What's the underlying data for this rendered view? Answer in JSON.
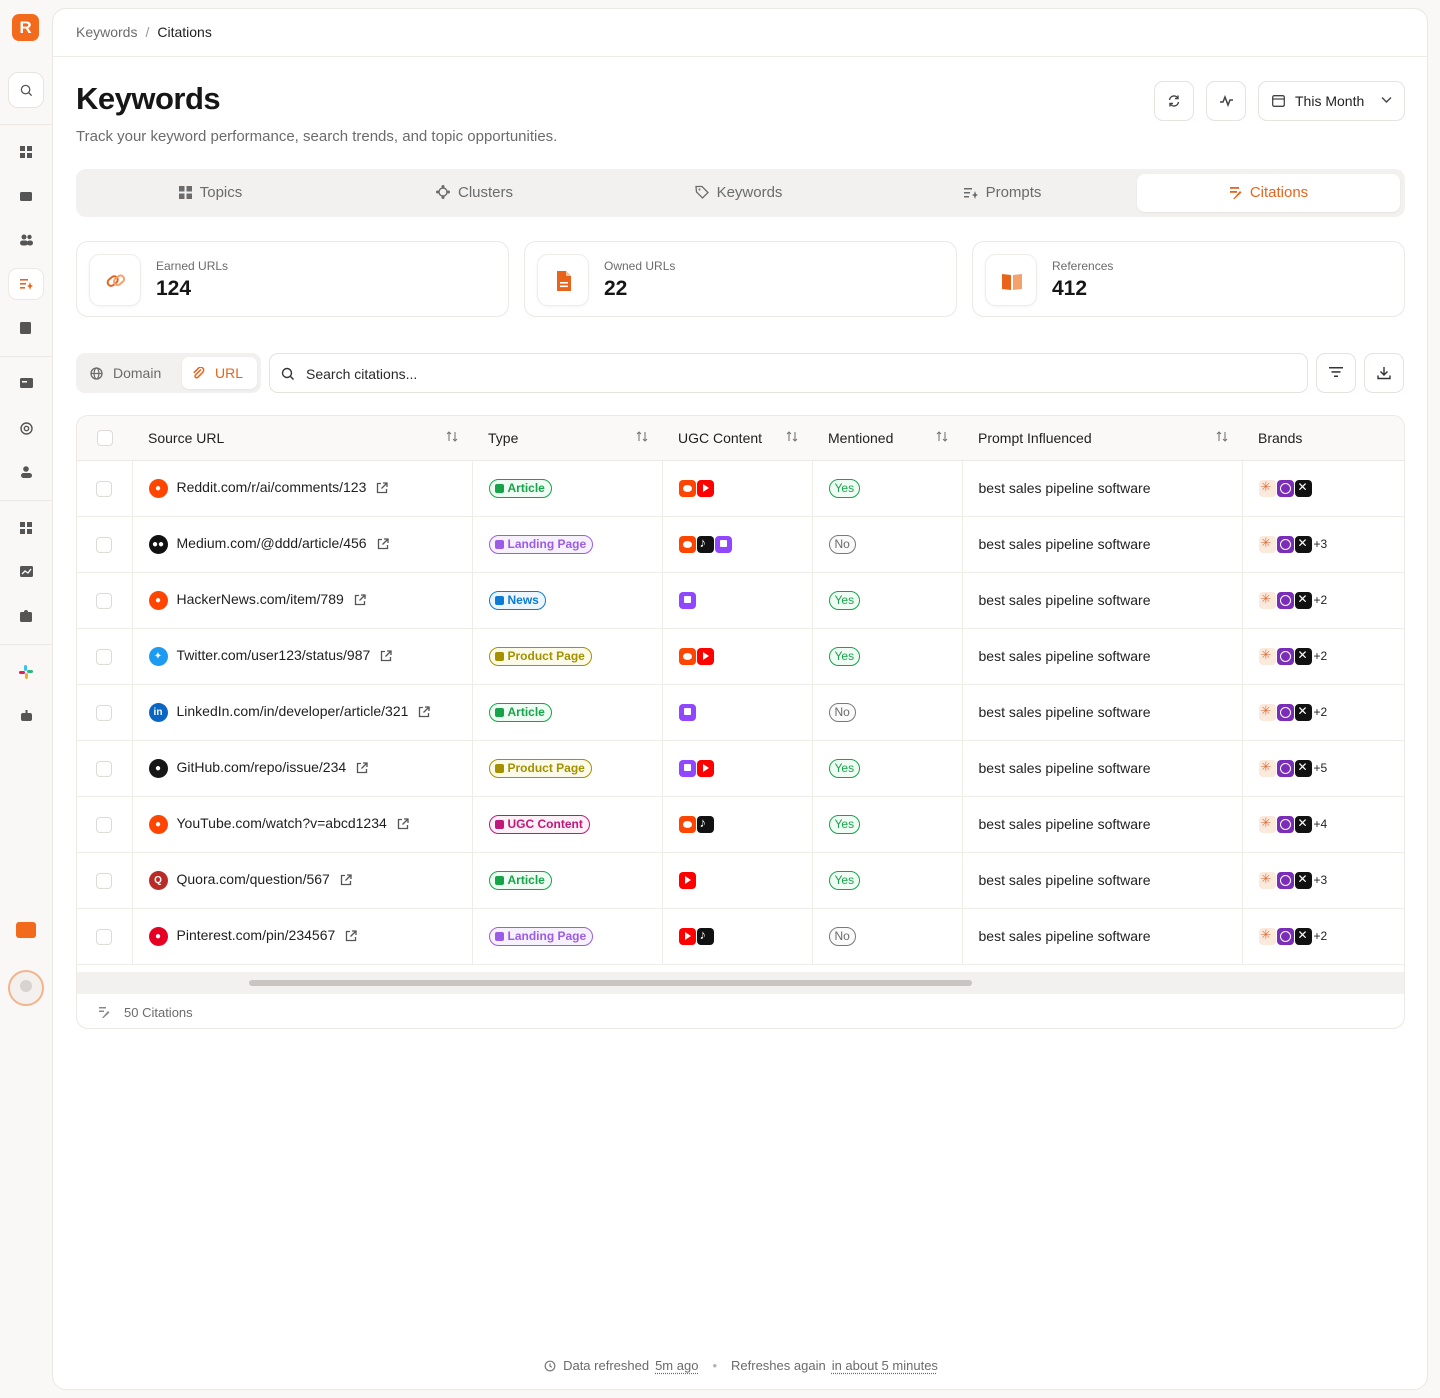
{
  "app": {
    "logo_letter": "R"
  },
  "breadcrumb": {
    "parent": "Keywords",
    "separator": "/",
    "current": "Citations"
  },
  "header": {
    "title": "Keywords",
    "subtitle": "Track your keyword performance, search trends, and topic opportunities.",
    "period_label": "This Month"
  },
  "tabs": [
    {
      "label": "Topics",
      "icon": "grid-icon"
    },
    {
      "label": "Clusters",
      "icon": "cluster-icon"
    },
    {
      "label": "Keywords",
      "icon": "tag-icon"
    },
    {
      "label": "Prompts",
      "icon": "prompt-icon"
    },
    {
      "label": "Citations",
      "icon": "citation-icon",
      "active": true
    }
  ],
  "stats": [
    {
      "label": "Earned URLs",
      "value": "124",
      "icon": "link-icon"
    },
    {
      "label": "Owned URLs",
      "value": "22",
      "icon": "file-icon"
    },
    {
      "label": "References",
      "value": "412",
      "icon": "book-icon"
    }
  ],
  "toolbar": {
    "segments": [
      {
        "label": "Domain"
      },
      {
        "label": "URL",
        "active": true
      }
    ],
    "search_placeholder": "Search citations..."
  },
  "table": {
    "columns": [
      "Source URL",
      "Type",
      "UGC Content",
      "Mentioned",
      "Prompt Influenced",
      "Brands"
    ],
    "rows": [
      {
        "source": "Reddit.com/r/ai/comments/123",
        "src_icon": "reddit",
        "type": "Article",
        "ugc": [
          "reddit",
          "youtube"
        ],
        "mentioned": "Yes",
        "prompt": "best sales pipeline software",
        "brands_more": ""
      },
      {
        "source": "Medium.com/@ddd/article/456",
        "src_icon": "medium",
        "type": "Landing Page",
        "ugc": [
          "reddit",
          "tiktok",
          "twitch"
        ],
        "mentioned": "No",
        "prompt": "best sales pipeline software",
        "brands_more": "+3"
      },
      {
        "source": "HackerNews.com/item/789",
        "src_icon": "reddit",
        "type": "News",
        "ugc": [
          "twitch"
        ],
        "mentioned": "Yes",
        "prompt": "best sales pipeline software",
        "brands_more": "+2"
      },
      {
        "source": "Twitter.com/user123/status/987",
        "src_icon": "twitter",
        "type": "Product Page",
        "ugc": [
          "reddit",
          "youtube"
        ],
        "mentioned": "Yes",
        "prompt": "best sales pipeline software",
        "brands_more": "+2"
      },
      {
        "source": "LinkedIn.com/in/developer/article/321",
        "src_icon": "linkedin",
        "type": "Article",
        "ugc": [
          "twitch"
        ],
        "mentioned": "No",
        "prompt": "best sales pipeline software",
        "brands_more": "+2"
      },
      {
        "source": "GitHub.com/repo/issue/234",
        "src_icon": "github",
        "type": "Product Page",
        "ugc": [
          "twitch",
          "youtube"
        ],
        "mentioned": "Yes",
        "prompt": "best sales pipeline software",
        "brands_more": "+5"
      },
      {
        "source": "YouTube.com/watch?v=abcd1234",
        "src_icon": "reddit",
        "type": "UGC Content",
        "ugc": [
          "reddit",
          "tiktok"
        ],
        "mentioned": "Yes",
        "prompt": "best sales pipeline software",
        "brands_more": "+4"
      },
      {
        "source": "Quora.com/question/567",
        "src_icon": "quora",
        "type": "Article",
        "ugc": [
          "youtube"
        ],
        "mentioned": "Yes",
        "prompt": "best sales pipeline software",
        "brands_more": "+3"
      },
      {
        "source": "Pinterest.com/pin/234567",
        "src_icon": "pinterest",
        "type": "Landing Page",
        "ugc": [
          "youtube",
          "tiktok"
        ],
        "mentioned": "No",
        "prompt": "best sales pipeline software",
        "brands_more": "+2"
      }
    ],
    "footer_count": "50 Citations"
  },
  "refresh": {
    "label": "Data refreshed",
    "ago": "5m ago",
    "next_label": "Refreshes again",
    "next": "in about 5 minutes"
  },
  "colors": {
    "accent": "#e8641a",
    "article": "#16a34a",
    "landing_page": "#9b5de5",
    "news": "#0b7bd4",
    "product_page": "#a39100",
    "ugc_content": "#c0187a"
  }
}
